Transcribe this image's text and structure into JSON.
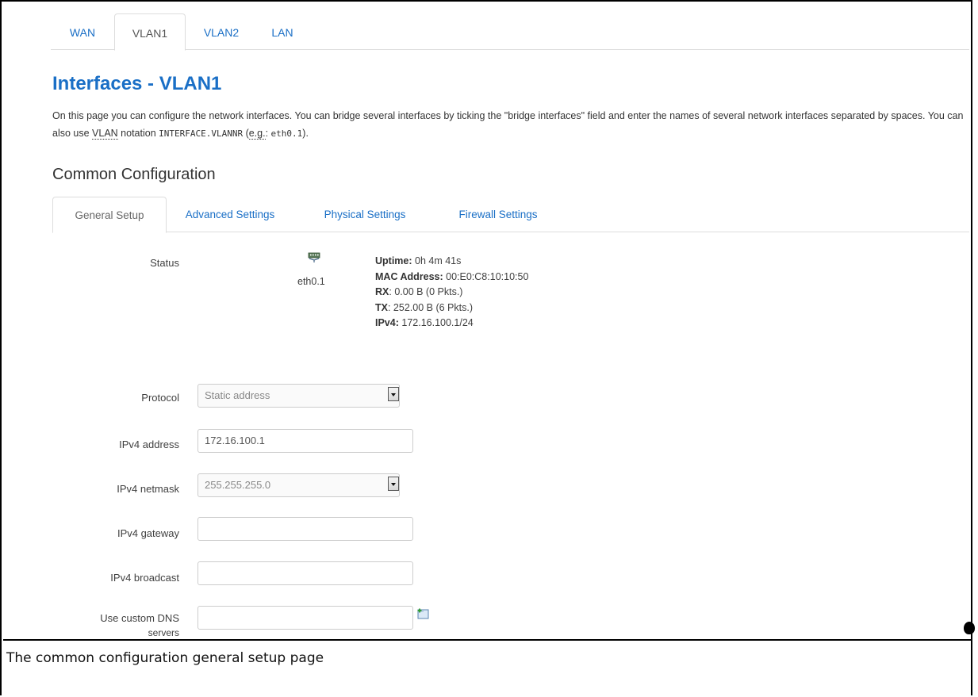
{
  "top_tabs": [
    {
      "label": "WAN",
      "active": false
    },
    {
      "label": "VLAN1",
      "active": true
    },
    {
      "label": "VLAN2",
      "active": false
    },
    {
      "label": "LAN",
      "active": false
    }
  ],
  "page": {
    "title": "Interfaces - VLAN1",
    "description_part1": "On this page you can configure the network interfaces. You can bridge several interfaces by ticking the \"bridge interfaces\" field and enter the names of several network interfaces separated by spaces. You can also use ",
    "description_abbr": "VLAN",
    "description_part2": " notation ",
    "description_code1": "INTERFACE.VLANNR",
    "description_part3": " (",
    "description_eg": "e.g.",
    "description_part4": ": ",
    "description_code2": "eth0.1",
    "description_part5": ")."
  },
  "section": {
    "title": "Common Configuration",
    "tabs": [
      {
        "label": "General Setup",
        "active": true
      },
      {
        "label": "Advanced Settings",
        "active": false
      },
      {
        "label": "Physical Settings",
        "active": false
      },
      {
        "label": "Firewall Settings",
        "active": false
      }
    ]
  },
  "status": {
    "label": "Status",
    "interface": "eth0.1",
    "icon": "network-interface-icon",
    "uptime_label": "Uptime:",
    "uptime_value": " 0h 4m 41s",
    "mac_label": "MAC Address:",
    "mac_value": " 00:E0:C8:10:10:50",
    "rx_label": "RX",
    "rx_value": ": 0.00 B (0 Pkts.)",
    "tx_label": "TX",
    "tx_value": ": 252.00 B (6 Pkts.)",
    "ipv4_label": "IPv4:",
    "ipv4_value": " 172.16.100.1/24"
  },
  "form": {
    "protocol_label": "Protocol",
    "protocol_value": "Static address",
    "ipv4_address_label": "IPv4 address",
    "ipv4_address_value": "172.16.100.1",
    "ipv4_netmask_label": "IPv4 netmask",
    "ipv4_netmask_value": "255.255.255.0",
    "ipv4_gateway_label": "IPv4 gateway",
    "ipv4_gateway_value": "",
    "ipv4_broadcast_label": "IPv4 broadcast",
    "ipv4_broadcast_value": "",
    "dns_label_line1": "Use custom DNS",
    "dns_label_line2": "servers",
    "dns_value": ""
  },
  "caption": "The common configuration general setup page",
  "colors": {
    "link": "#1a6fc6",
    "border": "#dddddd"
  }
}
